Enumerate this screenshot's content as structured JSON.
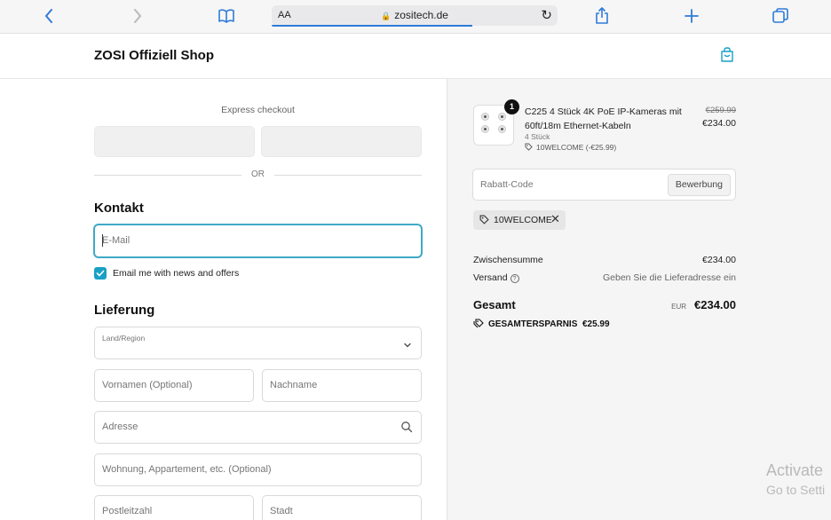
{
  "browser": {
    "text_size_label": "AA",
    "url": "zositech.de"
  },
  "shop": {
    "title": "ZOSI Offiziell Shop"
  },
  "checkout": {
    "express_label": "Express checkout",
    "or_label": "OR",
    "contact_heading": "Kontakt",
    "email_placeholder": "E-Mail",
    "newsletter_label": "Email me with news and offers",
    "newsletter_checked": true,
    "delivery_heading": "Lieferung",
    "country_label": "Land/Region",
    "first_name_placeholder": "Vornamen (Optional)",
    "last_name_placeholder": "Nachname",
    "address_placeholder": "Adresse",
    "apartment_placeholder": "Wohnung, Appartement, etc. (Optional)",
    "postal_placeholder": "Postleitzahl",
    "city_placeholder": "Stadt"
  },
  "summary": {
    "item": {
      "quantity_badge": "1",
      "name": "C225 4 Stück 4K PoE IP-Kameras mit 60ft/18m Ethernet-Kabeln",
      "variant": "4 Stück",
      "discount": "10WELCOME (-€25.99)",
      "original_price": "€259.99",
      "price": "€234.00"
    },
    "coupon_placeholder": "Rabatt-Code",
    "apply_label": "Bewerbung",
    "applied_code": "10WELCOME",
    "subtotal_label": "Zwischensumme",
    "subtotal_value": "€234.00",
    "shipping_label": "Versand",
    "shipping_value": "Geben Sie die Lieferadresse ein",
    "total_label": "Gesamt",
    "currency": "EUR",
    "total_value": "€234.00",
    "savings_label": "GESAMTERSPARNIS",
    "savings_value": "€25.99"
  },
  "os_overlay": {
    "activate_title": "Activate",
    "activate_subtitle": "Go to Setti"
  },
  "colors": {
    "accent": "#1aa0c6",
    "browser_blue": "#2f7bd9",
    "summary_bg": "#f5f5f5"
  }
}
